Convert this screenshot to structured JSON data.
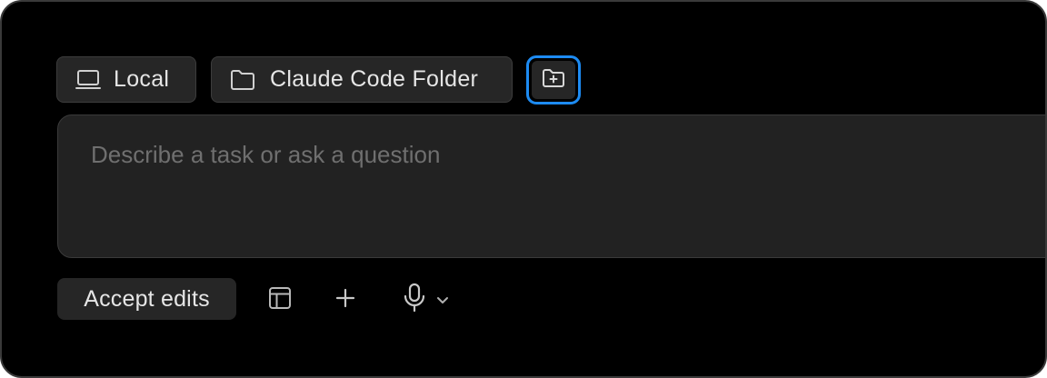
{
  "toolbar": {
    "environment_label": "Local",
    "environment_icon": "laptop-icon",
    "folder_label": "Claude Code Folder",
    "folder_icon": "folder-icon",
    "add_folder_icon": "folder-plus-icon"
  },
  "prompt": {
    "placeholder": "Describe a task or ask a question",
    "value": ""
  },
  "bottom_bar": {
    "mode_label": "Accept edits",
    "icons": [
      "layout-icon",
      "plus-icon",
      "microphone-icon",
      "chevron-down-icon"
    ]
  },
  "colors": {
    "background": "#000000",
    "chip": "#262626",
    "prompt_box": "#222222",
    "focus_ring": "#1d8bf2",
    "text": "#e6e6e6",
    "placeholder": "#6f6f6f"
  }
}
